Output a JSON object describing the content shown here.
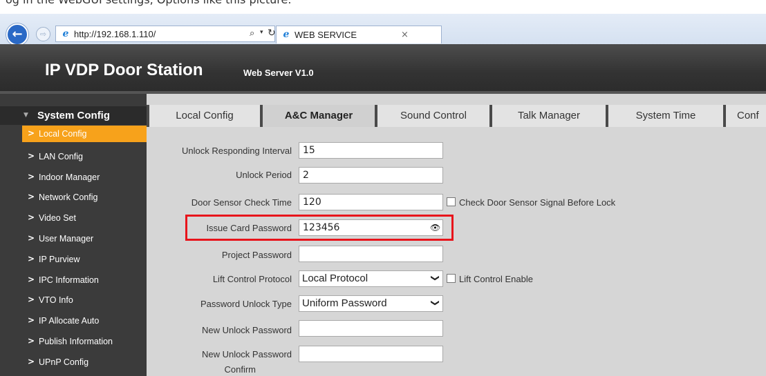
{
  "caption": "og in the WebGUI settings, Options like this picture.",
  "browser": {
    "url": "http://192.168.1.110/",
    "tab_title": "WEB SERVICE",
    "back_glyph": "←",
    "forward_glyph": "⇨",
    "search_glyph": "⌕",
    "dropdown_glyph": "▾",
    "refresh_glyph": "↻",
    "close_glyph": "×",
    "site_icon": "e"
  },
  "header": {
    "title": "IP VDP Door Station",
    "version": "Web Server V1.0"
  },
  "sidebar": {
    "section_label": "System Config",
    "expand_glyph": "▼",
    "chevron": ">",
    "items": [
      {
        "label": "Local Config",
        "active": true
      },
      {
        "label": "LAN Config"
      },
      {
        "label": "Indoor Manager"
      },
      {
        "label": "Network Config"
      },
      {
        "label": "Video Set"
      },
      {
        "label": "User Manager"
      },
      {
        "label": "IP Purview"
      },
      {
        "label": "IPC Information"
      },
      {
        "label": "VTO Info"
      },
      {
        "label": "IP Allocate Auto"
      },
      {
        "label": "Publish Information"
      },
      {
        "label": "UPnP Config"
      }
    ]
  },
  "tabs": [
    "Local Config",
    "A&C Manager",
    "Sound Control",
    "Talk Manager",
    "System Time",
    "Conf"
  ],
  "active_tab": "A&C Manager",
  "form": {
    "unlock_responding_interval": {
      "label": "Unlock Responding Interval",
      "value": "15"
    },
    "unlock_period": {
      "label": "Unlock Period",
      "value": "2"
    },
    "door_sensor_check_time": {
      "label": "Door Sensor Check Time",
      "value": "120"
    },
    "check_door_sensor": {
      "label": "Check Door Sensor Signal Before Lock",
      "checked": false
    },
    "issue_card_password": {
      "label": "Issue Card Password",
      "value": "123456",
      "reveal_glyph": "👁"
    },
    "project_password": {
      "label": "Project Password",
      "value": ""
    },
    "lift_control_protocol": {
      "label": "Lift Control Protocol",
      "value": "Local Protocol",
      "arrow": "❯"
    },
    "lift_control_enable": {
      "label": "Lift Control Enable",
      "checked": false
    },
    "password_unlock_type": {
      "label": "Password Unlock Type",
      "value": "Uniform Password",
      "arrow": "❯"
    },
    "new_unlock_password": {
      "label": "New Unlock Password",
      "value": ""
    },
    "new_unlock_password_confirm": {
      "label_line1": "New Unlock Password",
      "label_line2": "Confirm",
      "value": ""
    }
  },
  "colors": {
    "accent_active_nav": "#f7a21b",
    "highlight_border": "#e8141b",
    "header_bg": "#3a3a3a",
    "sidebar_bg": "#3b3b3b",
    "content_bg": "#d6d6d6"
  }
}
